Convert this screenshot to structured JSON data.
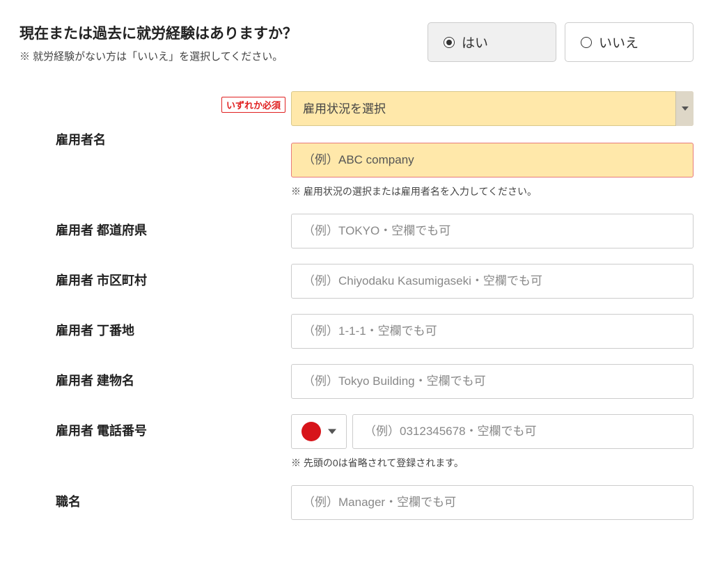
{
  "header": {
    "question": "現在または過去に就労経験はありますか？",
    "note": "※ 就労経験がない方は「いいえ」を選択してください。",
    "options": {
      "yes": "はい",
      "no": "いいえ",
      "selected": "yes"
    }
  },
  "required_badge": "いずれか必須",
  "fields": {
    "employer_name": {
      "label": "雇用者名",
      "select_placeholder": "雇用状況を選択",
      "text_placeholder": "（例）ABC company",
      "error_note": "※ 雇用状況の選択または雇用者名を入力してください。"
    },
    "prefecture": {
      "label": "雇用者 都道府県",
      "placeholder": "（例）TOKYO・空欄でも可"
    },
    "city": {
      "label": "雇用者 市区町村",
      "placeholder": "（例）Chiyodaku Kasumigaseki・空欄でも可"
    },
    "street": {
      "label": "雇用者 丁番地",
      "placeholder": "（例）1-1-1・空欄でも可"
    },
    "building": {
      "label": "雇用者 建物名",
      "placeholder": "（例）Tokyo Building・空欄でも可"
    },
    "phone": {
      "label": "雇用者 電話番号",
      "placeholder": "（例）0312345678・空欄でも可",
      "note": "※ 先頭の0は省略されて登録されます。",
      "country": "JP"
    },
    "job_title": {
      "label": "職名",
      "placeholder": "（例）Manager・空欄でも可"
    }
  }
}
